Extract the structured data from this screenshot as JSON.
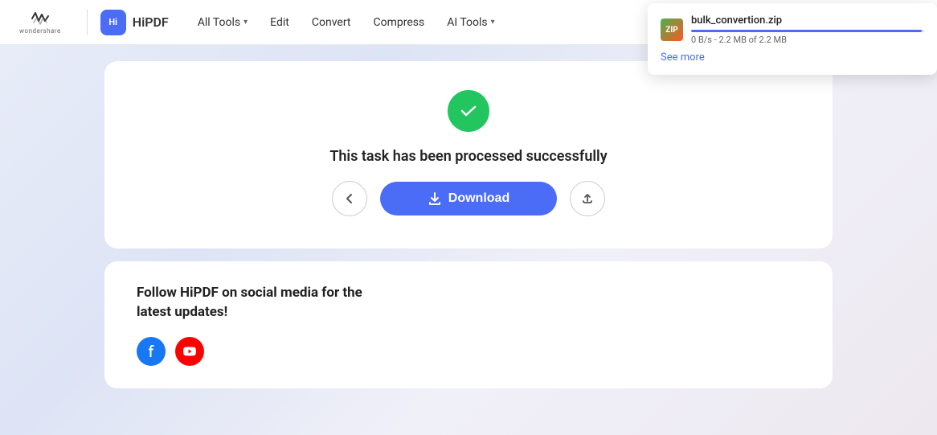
{
  "header": {
    "wondershare_text": "wondershare",
    "hipdf_label": "HiPDF",
    "nav": {
      "all_tools": "All Tools",
      "edit": "Edit",
      "convert": "Convert",
      "compress": "Compress",
      "ai_tools": "AI Tools"
    }
  },
  "success_card": {
    "title": "This task has been processed successfully",
    "download_label": "Download",
    "back_icon": "‹",
    "upload_icon": "↑"
  },
  "social_card": {
    "title": "Follow HiPDF on social media for the latest updates!"
  },
  "download_popup": {
    "filename": "bulk_convertion.zip",
    "progress_text": "0 B/s - 2.2 MB of 2.2 MB",
    "progress_percent": 99,
    "see_more": "See more",
    "file_icon_text": "ZIP"
  }
}
